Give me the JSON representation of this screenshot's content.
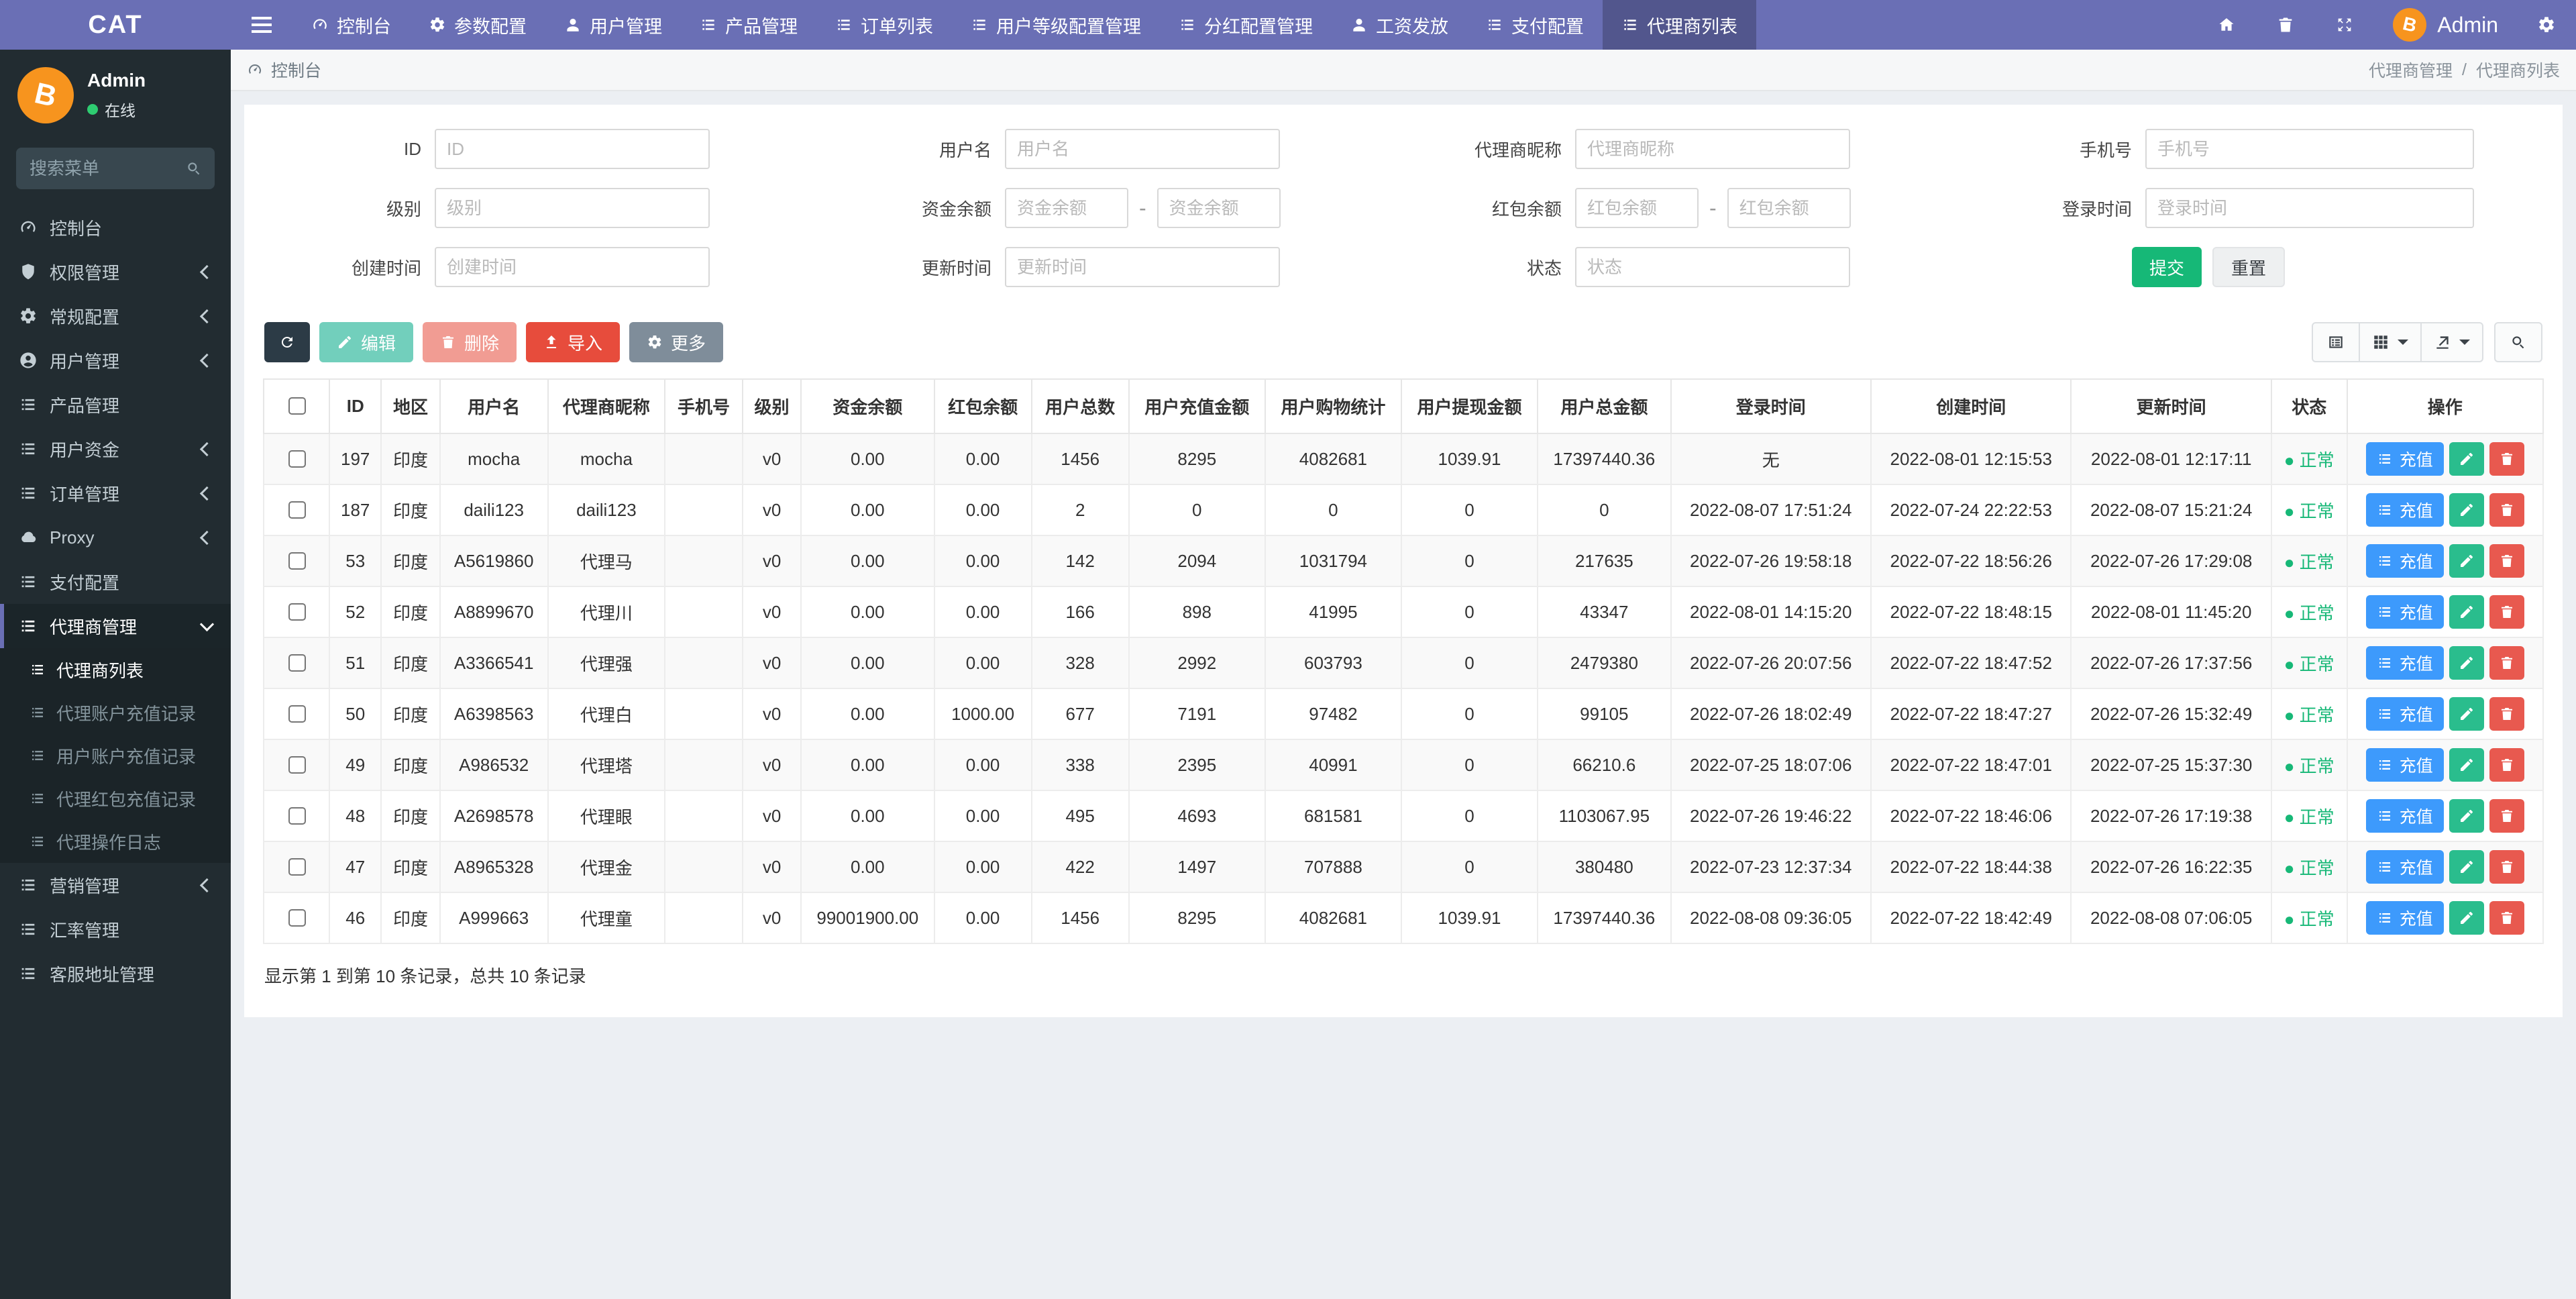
{
  "colors": {
    "navbar": "#6a6fb5",
    "sidebar": "#222c31",
    "accent_green": "#16b877",
    "accent_red": "#e74c3c",
    "accent_blue": "#3d9afc",
    "avatar_orange": "#f7941e",
    "status_green": "#17b877"
  },
  "topnav": {
    "brand": "CAT",
    "items": [
      {
        "id": "console",
        "icon": "gauge",
        "label": "控制台",
        "active": false
      },
      {
        "id": "params",
        "icon": "gear",
        "label": "参数配置",
        "active": false
      },
      {
        "id": "users",
        "icon": "user",
        "label": "用户管理",
        "active": false
      },
      {
        "id": "products",
        "icon": "list",
        "label": "产品管理",
        "active": false
      },
      {
        "id": "orders",
        "icon": "list",
        "label": "订单列表",
        "active": false
      },
      {
        "id": "userlevel",
        "icon": "list",
        "label": "用户等级配置管理",
        "active": false
      },
      {
        "id": "dividend",
        "icon": "list",
        "label": "分红配置管理",
        "active": false
      },
      {
        "id": "salary",
        "icon": "user",
        "label": "工资发放",
        "active": false
      },
      {
        "id": "payment",
        "icon": "list",
        "label": "支付配置",
        "active": false
      },
      {
        "id": "agentlist",
        "icon": "list",
        "label": "代理商列表",
        "active": true
      }
    ],
    "user": "Admin"
  },
  "sidebar": {
    "user": {
      "name": "Admin",
      "status": "在线"
    },
    "search_placeholder": "搜索菜单",
    "items": [
      {
        "id": "console",
        "icon": "gauge",
        "label": "控制台",
        "chevron": false
      },
      {
        "id": "permission",
        "icon": "shield",
        "label": "权限管理",
        "chevron": true
      },
      {
        "id": "general-config",
        "icon": "gear",
        "label": "常规配置",
        "chevron": true
      },
      {
        "id": "user-mgmt",
        "icon": "usercircle",
        "label": "用户管理",
        "chevron": true
      },
      {
        "id": "product-mgmt",
        "icon": "list",
        "label": "产品管理",
        "chevron": false
      },
      {
        "id": "user-funds",
        "icon": "list",
        "label": "用户资金",
        "chevron": true
      },
      {
        "id": "order-mgmt",
        "icon": "list",
        "label": "订单管理",
        "chevron": true
      },
      {
        "id": "proxy",
        "icon": "cloud",
        "label": "Proxy",
        "chevron": true
      },
      {
        "id": "pay-config",
        "icon": "list",
        "label": "支付配置",
        "chevron": false
      },
      {
        "id": "agent-mgmt",
        "icon": "list",
        "label": "代理商管理",
        "chevron": false,
        "expanded": true,
        "active": true,
        "children": [
          {
            "id": "agent-list",
            "label": "代理商列表",
            "active": true
          },
          {
            "id": "agent-recharge-log",
            "label": "代理账户充值记录",
            "active": false
          },
          {
            "id": "user-recharge-log",
            "label": "用户账户充值记录",
            "active": false
          },
          {
            "id": "agent-redpacket-log",
            "label": "代理红包充值记录",
            "active": false
          },
          {
            "id": "agent-op-log",
            "label": "代理操作日志",
            "active": false
          }
        ]
      },
      {
        "id": "marketing",
        "icon": "list",
        "label": "营销管理",
        "chevron": true
      },
      {
        "id": "exchange-rate",
        "icon": "list",
        "label": "汇率管理",
        "chevron": false
      },
      {
        "id": "service-addr",
        "icon": "list",
        "label": "客服地址管理",
        "chevron": false
      }
    ]
  },
  "breadcrumb": {
    "left": "控制台",
    "section": "代理商管理",
    "separator": "/",
    "page": "代理商列表"
  },
  "filters": {
    "fields": [
      {
        "label": "ID",
        "type": "single",
        "placeholder": "ID"
      },
      {
        "label": "用户名",
        "type": "single",
        "placeholder": "用户名"
      },
      {
        "label": "代理商昵称",
        "type": "single",
        "placeholder": "代理商昵称"
      },
      {
        "label": "手机号",
        "type": "single",
        "placeholder": "手机号"
      },
      {
        "label": "级别",
        "type": "single",
        "placeholder": "级别"
      },
      {
        "label": "资金余额",
        "type": "range",
        "placeholder": "资金余额",
        "placeholder2": "资金余额",
        "dash": "-"
      },
      {
        "label": "红包余额",
        "type": "range",
        "placeholder": "红包余额",
        "placeholder2": "红包余额",
        "dash": "-"
      },
      {
        "label": "登录时间",
        "type": "single",
        "placeholder": "登录时间"
      },
      {
        "label": "创建时间",
        "type": "single",
        "placeholder": "创建时间"
      },
      {
        "label": "更新时间",
        "type": "single",
        "placeholder": "更新时间"
      },
      {
        "label": "状态",
        "type": "single",
        "placeholder": "状态"
      },
      {
        "type": "buttons"
      }
    ],
    "submit": "提交",
    "reset": "重置"
  },
  "toolbar": {
    "edit": "编辑",
    "delete": "删除",
    "import": "导入",
    "more": "更多"
  },
  "table": {
    "columns": [
      "ID",
      "地区",
      "用户名",
      "代理商昵称",
      "手机号",
      "级别",
      "资金余额",
      "红包余额",
      "用户总数",
      "用户充值金额",
      "用户购物统计",
      "用户提现金额",
      "用户总金额",
      "登录时间",
      "创建时间",
      "更新时间",
      "状态",
      "操作"
    ],
    "recharge": "充值",
    "rows": [
      {
        "cells": [
          "197",
          "印度",
          "mocha",
          "mocha",
          "",
          "v0",
          "0.00",
          "0.00",
          "1456",
          "8295",
          "4082681",
          "1039.91",
          "17397440.36",
          "无",
          "2022-08-01 12:15:53",
          "2022-08-01 12:17:11"
        ],
        "status": "正常"
      },
      {
        "cells": [
          "187",
          "印度",
          "daili123",
          "daili123",
          "",
          "v0",
          "0.00",
          "0.00",
          "2",
          "0",
          "0",
          "0",
          "0",
          "2022-08-07 17:51:24",
          "2022-07-24 22:22:53",
          "2022-08-07 15:21:24"
        ],
        "status": "正常"
      },
      {
        "cells": [
          "53",
          "印度",
          "A5619860",
          "代理马",
          "",
          "v0",
          "0.00",
          "0.00",
          "142",
          "2094",
          "1031794",
          "0",
          "217635",
          "2022-07-26 19:58:18",
          "2022-07-22 18:56:26",
          "2022-07-26 17:29:08"
        ],
        "status": "正常"
      },
      {
        "cells": [
          "52",
          "印度",
          "A8899670",
          "代理川",
          "",
          "v0",
          "0.00",
          "0.00",
          "166",
          "898",
          "41995",
          "0",
          "43347",
          "2022-08-01 14:15:20",
          "2022-07-22 18:48:15",
          "2022-08-01 11:45:20"
        ],
        "status": "正常"
      },
      {
        "cells": [
          "51",
          "印度",
          "A3366541",
          "代理强",
          "",
          "v0",
          "0.00",
          "0.00",
          "328",
          "2992",
          "603793",
          "0",
          "2479380",
          "2022-07-26 20:07:56",
          "2022-07-22 18:47:52",
          "2022-07-26 17:37:56"
        ],
        "status": "正常"
      },
      {
        "cells": [
          "50",
          "印度",
          "A6398563",
          "代理白",
          "",
          "v0",
          "0.00",
          "1000.00",
          "677",
          "7191",
          "97482",
          "0",
          "99105",
          "2022-07-26 18:02:49",
          "2022-07-22 18:47:27",
          "2022-07-26 15:32:49"
        ],
        "status": "正常"
      },
      {
        "cells": [
          "49",
          "印度",
          "A986532",
          "代理塔",
          "",
          "v0",
          "0.00",
          "0.00",
          "338",
          "2395",
          "40991",
          "0",
          "66210.6",
          "2022-07-25 18:07:06",
          "2022-07-22 18:47:01",
          "2022-07-25 15:37:30"
        ],
        "status": "正常"
      },
      {
        "cells": [
          "48",
          "印度",
          "A2698578",
          "代理眼",
          "",
          "v0",
          "0.00",
          "0.00",
          "495",
          "4693",
          "681581",
          "0",
          "1103067.95",
          "2022-07-26 19:46:22",
          "2022-07-22 18:46:06",
          "2022-07-26 17:19:38"
        ],
        "status": "正常"
      },
      {
        "cells": [
          "47",
          "印度",
          "A8965328",
          "代理金",
          "",
          "v0",
          "0.00",
          "0.00",
          "422",
          "1497",
          "707888",
          "0",
          "380480",
          "2022-07-23 12:37:34",
          "2022-07-22 18:44:38",
          "2022-07-26 16:22:35"
        ],
        "status": "正常"
      },
      {
        "cells": [
          "46",
          "印度",
          "A999663",
          "代理童",
          "",
          "v0",
          "99001900.00",
          "0.00",
          "1456",
          "8295",
          "4082681",
          "1039.91",
          "17397440.36",
          "2022-08-08 09:36:05",
          "2022-07-22 18:42:49",
          "2022-08-08 07:06:05"
        ],
        "status": "正常"
      }
    ]
  },
  "summary": "显示第 1 到第 10 条记录，总共 10 条记录"
}
